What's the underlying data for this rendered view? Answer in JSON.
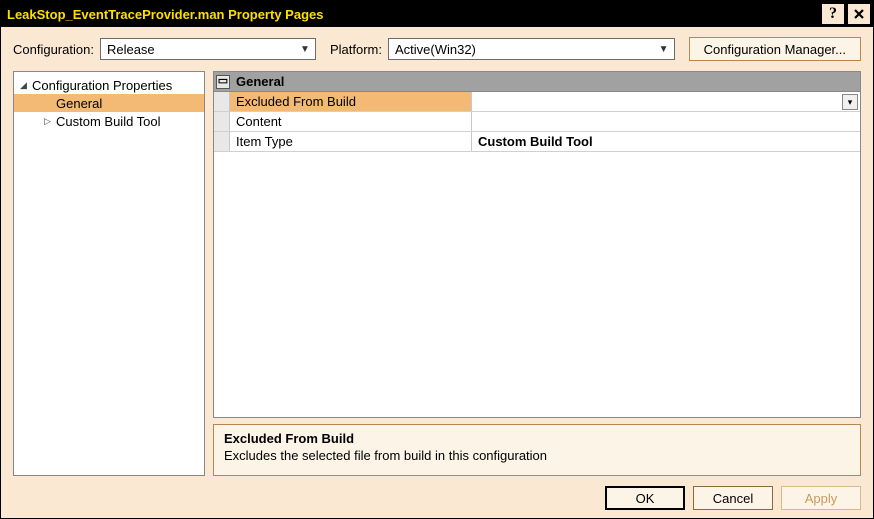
{
  "title": "LeakStop_EventTraceProvider.man Property Pages",
  "toolbar": {
    "configuration_label": "Configuration:",
    "configuration_value": "Release",
    "platform_label": "Platform:",
    "platform_value": "Active(Win32)",
    "config_manager_label": "Configuration Manager..."
  },
  "tree": {
    "root": "Configuration Properties",
    "items": [
      "General",
      "Custom Build Tool"
    ],
    "selected": "General"
  },
  "grid": {
    "category": "General",
    "rows": [
      {
        "name": "Excluded From Build",
        "value": "",
        "selected": true,
        "dropdown": true
      },
      {
        "name": "Content",
        "value": "",
        "selected": false,
        "dropdown": false
      },
      {
        "name": "Item Type",
        "value": "Custom Build Tool",
        "selected": false,
        "bold": true,
        "dropdown": false
      }
    ]
  },
  "description": {
    "title": "Excluded From Build",
    "text": "Excludes the selected file from build in this configuration"
  },
  "buttons": {
    "ok": "OK",
    "cancel": "Cancel",
    "apply": "Apply"
  }
}
